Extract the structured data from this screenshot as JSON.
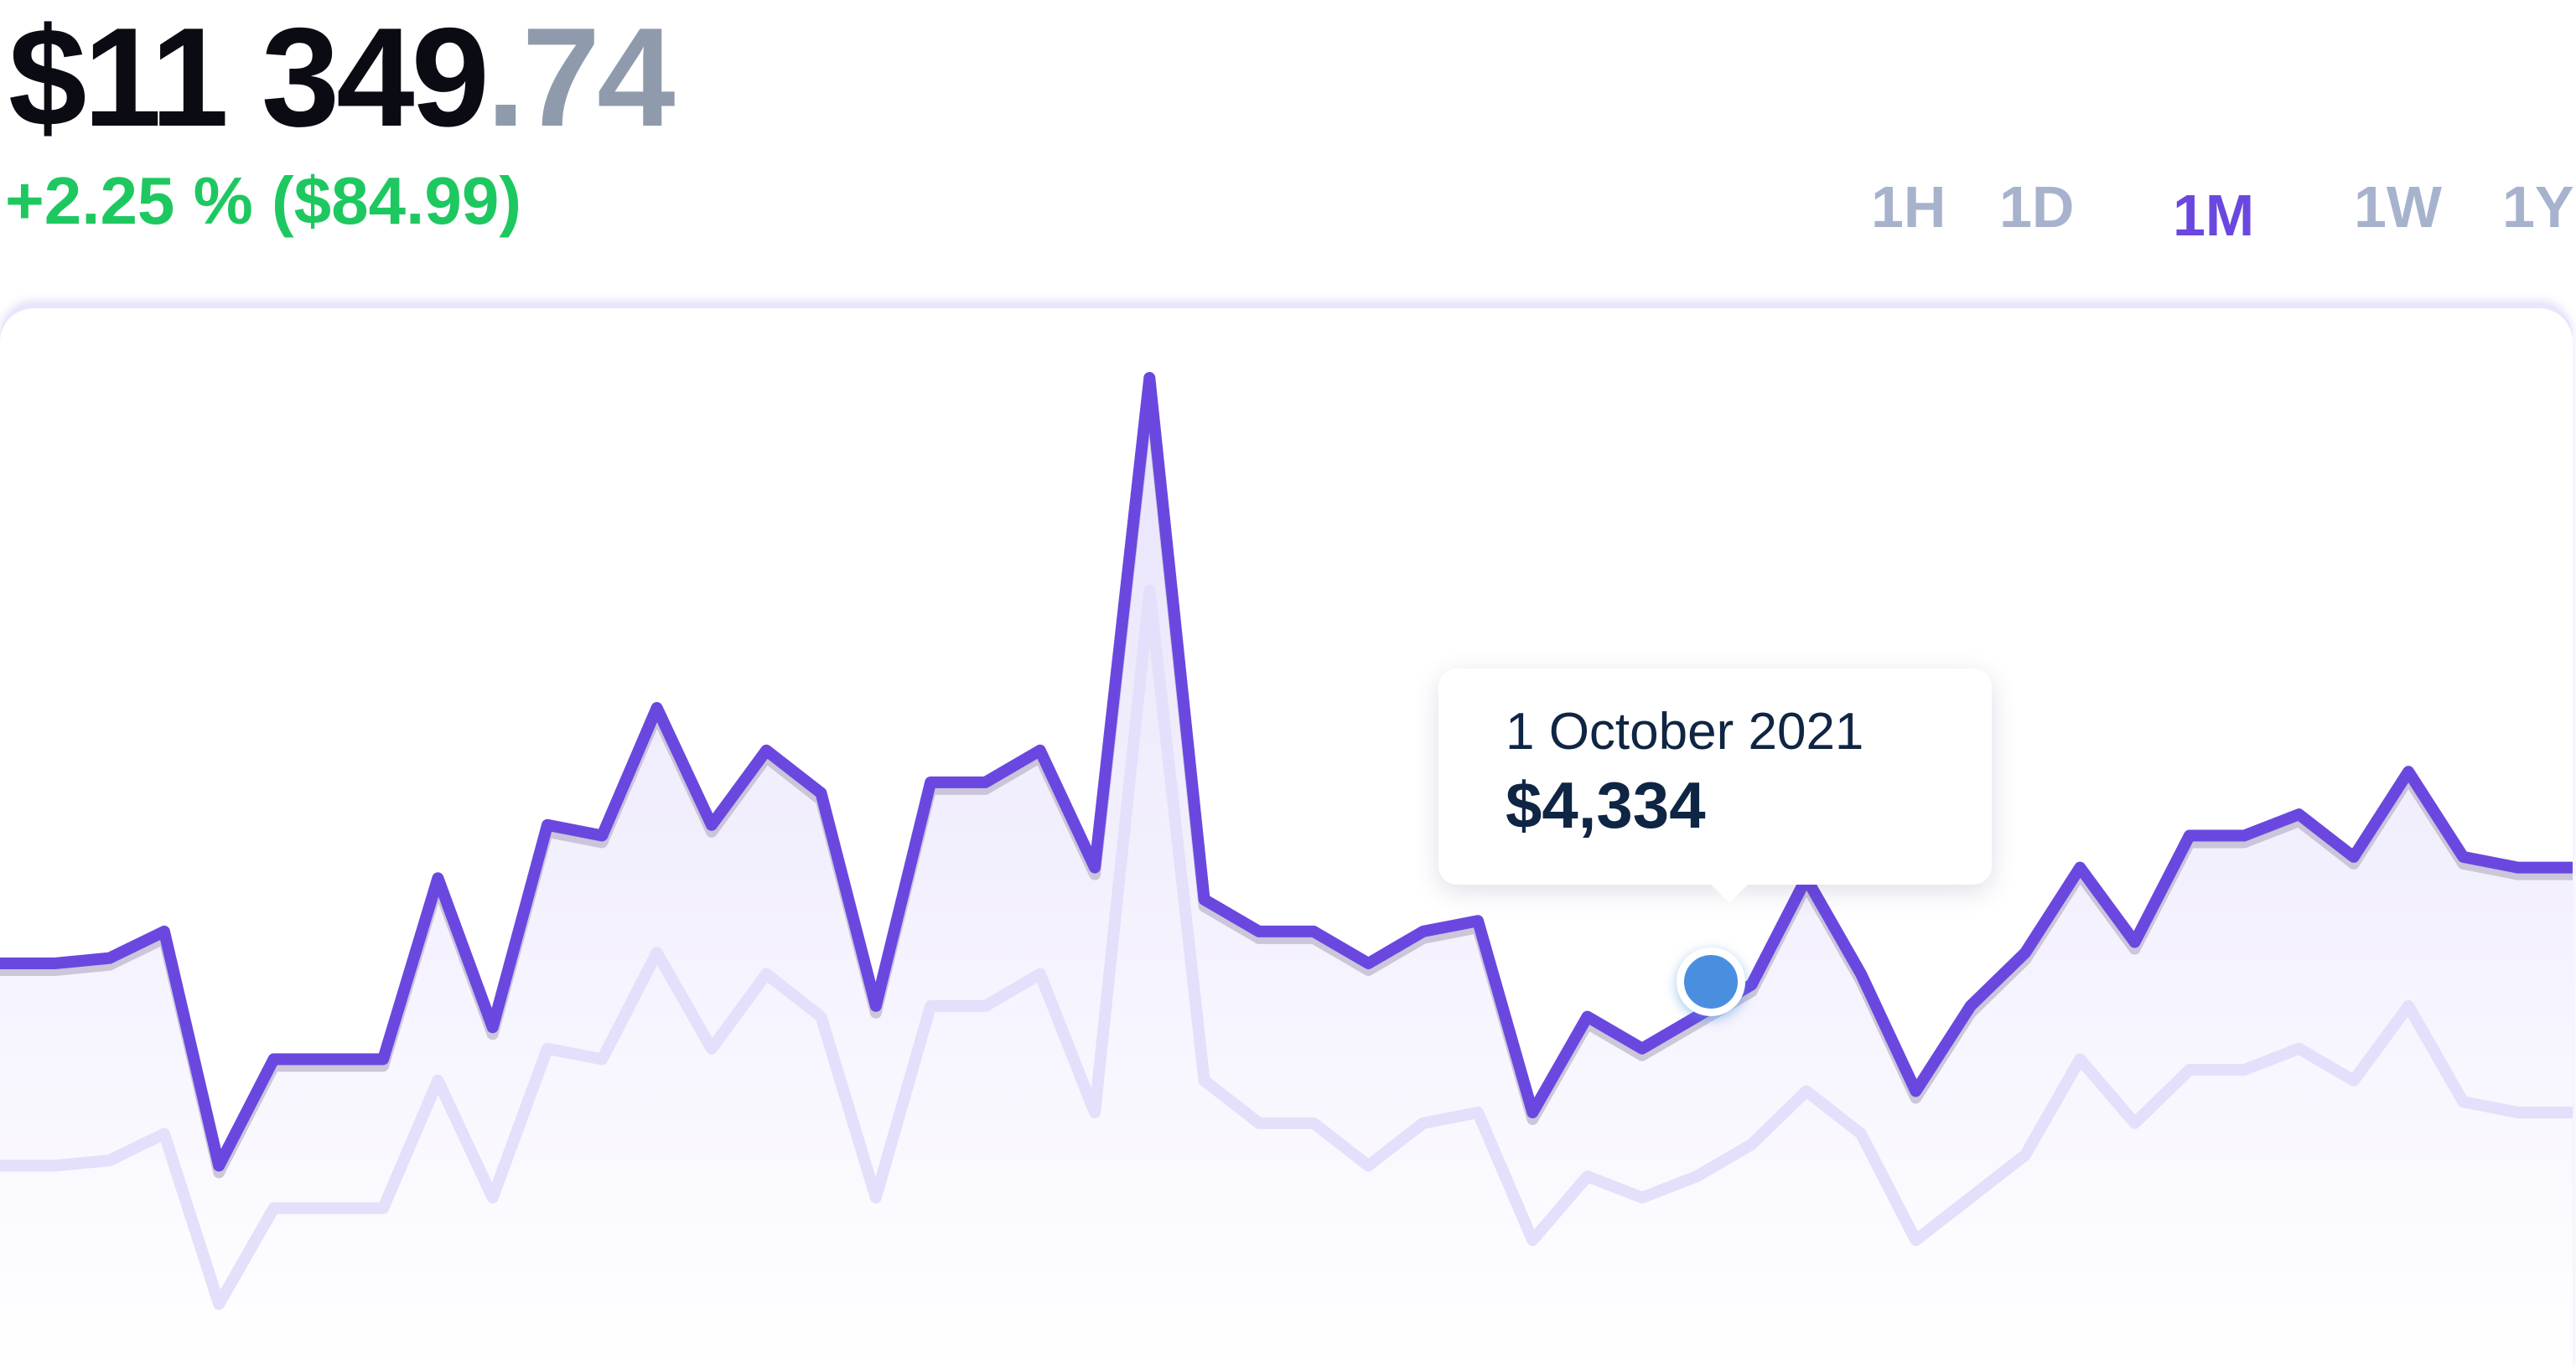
{
  "header": {
    "balance_integer": "$11 349",
    "balance_decimal": ".74",
    "change": "+2.25 % ($84.99)"
  },
  "periods": [
    {
      "label": "1H",
      "active": false
    },
    {
      "label": "1D",
      "active": false
    },
    {
      "label": "1M",
      "active": true
    },
    {
      "label": "1W",
      "active": false
    },
    {
      "label": "1Y",
      "active": false
    }
  ],
  "tooltip": {
    "date": "1 October 2021",
    "value": "$4,334"
  },
  "colors": {
    "accent": "#6a48e0",
    "positive": "#1ec860",
    "marker": "#4a8fdf",
    "muted": "#a7b3cd"
  },
  "chart_data": {
    "type": "line",
    "series": [
      {
        "values": [
          0.38,
          0.38,
          0.385,
          0.41,
          0.19,
          0.29,
          0.29,
          0.29,
          0.46,
          0.32,
          0.51,
          0.5,
          0.62,
          0.51,
          0.58,
          0.54,
          0.34,
          0.55,
          0.55,
          0.58,
          0.47,
          0.93,
          0.44,
          0.41,
          0.41,
          0.38,
          0.41,
          0.42,
          0.24,
          0.33,
          0.3,
          0.33,
          0.36,
          0.46,
          0.37,
          0.26,
          0.34,
          0.39,
          0.47,
          0.4,
          0.5,
          0.5,
          0.52,
          0.48,
          0.56,
          0.48,
          0.47,
          0.47
        ]
      },
      {
        "values": [
          0.19,
          0.19,
          0.195,
          0.22,
          0.06,
          0.15,
          0.15,
          0.15,
          0.27,
          0.16,
          0.3,
          0.29,
          0.39,
          0.3,
          0.37,
          0.33,
          0.16,
          0.34,
          0.34,
          0.37,
          0.24,
          0.73,
          0.27,
          0.23,
          0.23,
          0.19,
          0.23,
          0.24,
          0.12,
          0.18,
          0.16,
          0.18,
          0.21,
          0.26,
          0.22,
          0.12,
          0.16,
          0.2,
          0.29,
          0.23,
          0.28,
          0.28,
          0.3,
          0.27,
          0.34,
          0.25,
          0.24,
          0.24
        ]
      }
    ],
    "tooltip_index": 32
  }
}
